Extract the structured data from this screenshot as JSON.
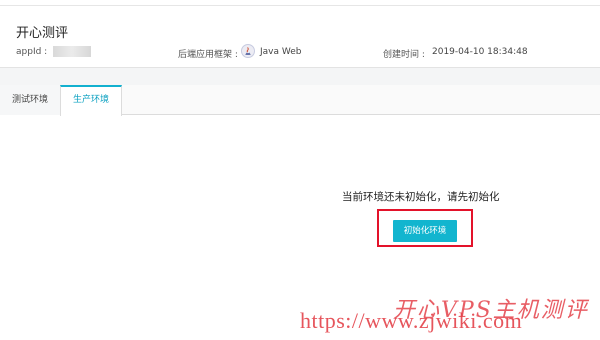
{
  "header": {
    "title": "开心测评",
    "appid_label": "appId :",
    "framework_label": "后端应用框架 :",
    "framework_value": "Java Web",
    "created_label": "创建时间 :",
    "created_value": "2019-04-10 18:34:48"
  },
  "tabs": [
    {
      "label": "测试环境",
      "active": false
    },
    {
      "label": "生产环境",
      "active": true
    }
  ],
  "main": {
    "empty_message": "当前环境还未初始化，请先初始化",
    "init_button_label": "初始化环境"
  },
  "watermark": {
    "brand": "开心VPS主机测评",
    "url": "https://www.zjwiki.com"
  },
  "colors": {
    "accent": "#12b5cf",
    "highlight": "#e3122a",
    "watermark": "#e4434b"
  },
  "icons": {
    "framework": "java-web-icon"
  }
}
